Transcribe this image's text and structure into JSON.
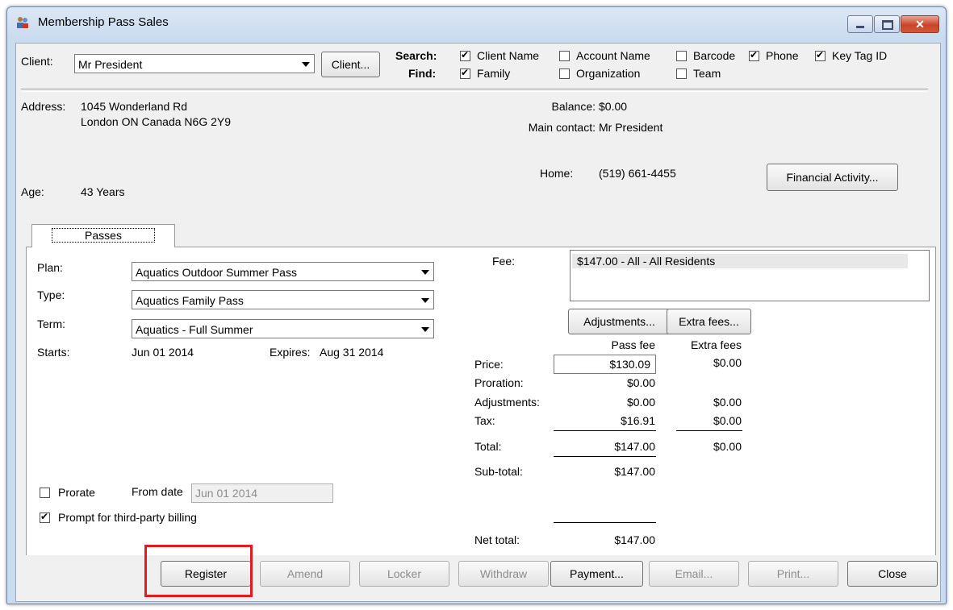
{
  "window": {
    "title": "Membership Pass Sales",
    "close_glyph": "✕"
  },
  "client": {
    "label": "Client:",
    "value": "Mr President",
    "button": "Client..."
  },
  "search": {
    "search_label": "Search:",
    "find_label": "Find:",
    "options": [
      {
        "label": "Client Name",
        "checked": true
      },
      {
        "label": "Account Name",
        "checked": false
      },
      {
        "label": "Barcode",
        "checked": false
      },
      {
        "label": "Phone",
        "checked": true
      },
      {
        "label": "Key Tag ID",
        "checked": true
      }
    ],
    "find_options": [
      {
        "label": "Family",
        "checked": true
      },
      {
        "label": "Organization",
        "checked": false
      },
      {
        "label": "Team",
        "checked": false
      }
    ]
  },
  "info": {
    "address_label": "Address:",
    "address_line1": "1045 Wonderland Rd",
    "address_line2": "London ON Canada  N6G 2Y9",
    "age_label": "Age:",
    "age_value": "43 Years",
    "balance_label": "Balance:",
    "balance_value": "$0.00",
    "main_contact_label": "Main contact:",
    "main_contact_value": "Mr President",
    "home_label": "Home:",
    "home_value": "(519) 661-4455",
    "financial_button": "Financial Activity..."
  },
  "tab": {
    "label": "Passes"
  },
  "pass": {
    "plan_label": "Plan:",
    "plan_value": "Aquatics Outdoor Summer Pass",
    "type_label": "Type:",
    "type_value": "Aquatics Family Pass",
    "term_label": "Term:",
    "term_value": "Aquatics - Full Summer",
    "starts_label": "Starts:",
    "starts_value": "Jun 01 2014",
    "expires_label": "Expires:",
    "expires_value": "Aug 31 2014",
    "prorate_label": "Prorate",
    "from_date_label": "From date",
    "from_date_value": "Jun 01 2014",
    "third_party_label": "Prompt for third-party billing"
  },
  "fees": {
    "fee_label": "Fee:",
    "fee_item": "$147.00 - All - All Residents",
    "adjustments_button": "Adjustments...",
    "extra_fees_button": "Extra fees...",
    "col_pass": "Pass fee",
    "col_extra": "Extra fees",
    "price_label": "Price:",
    "price_pass": "$130.09",
    "price_extra": "$0.00",
    "proration_label": "Proration:",
    "proration_pass": "$0.00",
    "adjustments_label": "Adjustments:",
    "adjustments_pass": "$0.00",
    "adjustments_extra": "$0.00",
    "tax_label": "Tax:",
    "tax_pass": "$16.91",
    "tax_extra": "$0.00",
    "total_label": "Total:",
    "total_pass": "$147.00",
    "total_extra": "$0.00",
    "subtotal_label": "Sub-total:",
    "subtotal_pass": "$147.00",
    "net_label": "Net total:",
    "net_pass": "$147.00"
  },
  "buttons": {
    "register": "Register",
    "amend": "Amend",
    "locker": "Locker",
    "withdraw": "Withdraw",
    "payment": "Payment...",
    "email": "Email...",
    "print": "Print...",
    "close": "Close"
  },
  "colors": {
    "highlight": "#e21c1c",
    "title_bar": "#c9dbee"
  }
}
